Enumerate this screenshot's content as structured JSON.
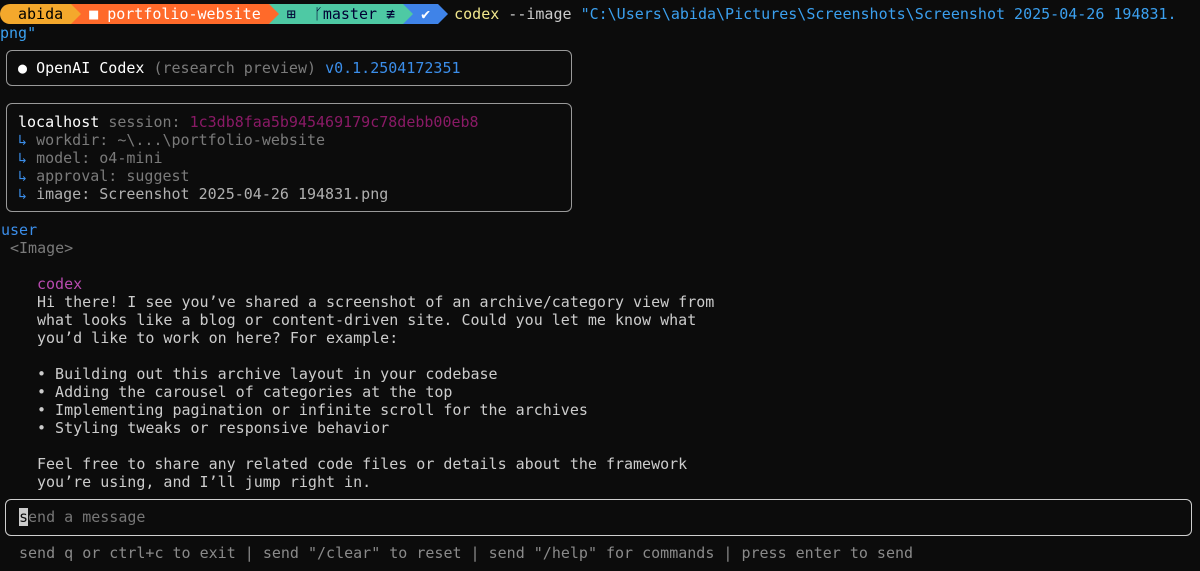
{
  "prompt": {
    "user": "abida",
    "path_icon": "folder-icon",
    "path": "portfolio-website",
    "git_icon": "git-branch-icon",
    "branch": "master ≢",
    "status": "✔",
    "command": "codex",
    "flag": " --image ",
    "arg_line1": "\"C:\\Users\\abida\\Pictures\\Screenshots\\Screenshot 2025-04-26 194831.",
    "arg_line2": "png\""
  },
  "header_box": {
    "bullet": "●",
    "name": "OpenAI Codex",
    "tag": "(research preview)",
    "version": "v0.1.2504172351"
  },
  "session_box": {
    "host": "localhost",
    "session_label": "session:",
    "session_id": "1c3db8faa5b945469179c78debb00eb8",
    "branch_glyph": "↳",
    "workdir": "workdir: ~\\...\\portfolio-website",
    "model": "model: o4-mini",
    "approval": "approval: suggest",
    "image": "image: Screenshot 2025-04-26 194831.png"
  },
  "chat": {
    "user_role": "user",
    "user_msg": "<Image>",
    "codex_role": "codex",
    "lines": [
      "Hi there! I see you’ve shared a screenshot of an archive/category view from",
      "what looks like a blog or content-driven site. Could you let me know what",
      "you’d like to work on here? For example:",
      "",
      "• Building out this archive layout in your codebase",
      "• Adding the carousel of categories at the top",
      "• Implementing pagination or infinite scroll for the archives",
      "• Styling tweaks or responsive behavior",
      "",
      "Feel free to share any related code files or details about the framework",
      "you’re using, and I’ll jump right in."
    ]
  },
  "input": {
    "cursor_char": "s",
    "placeholder_rest": "end a message"
  },
  "footer": "send q or ctrl+c to exit | send \"/clear\" to reset | send \"/help\" for commands | press enter to send"
}
